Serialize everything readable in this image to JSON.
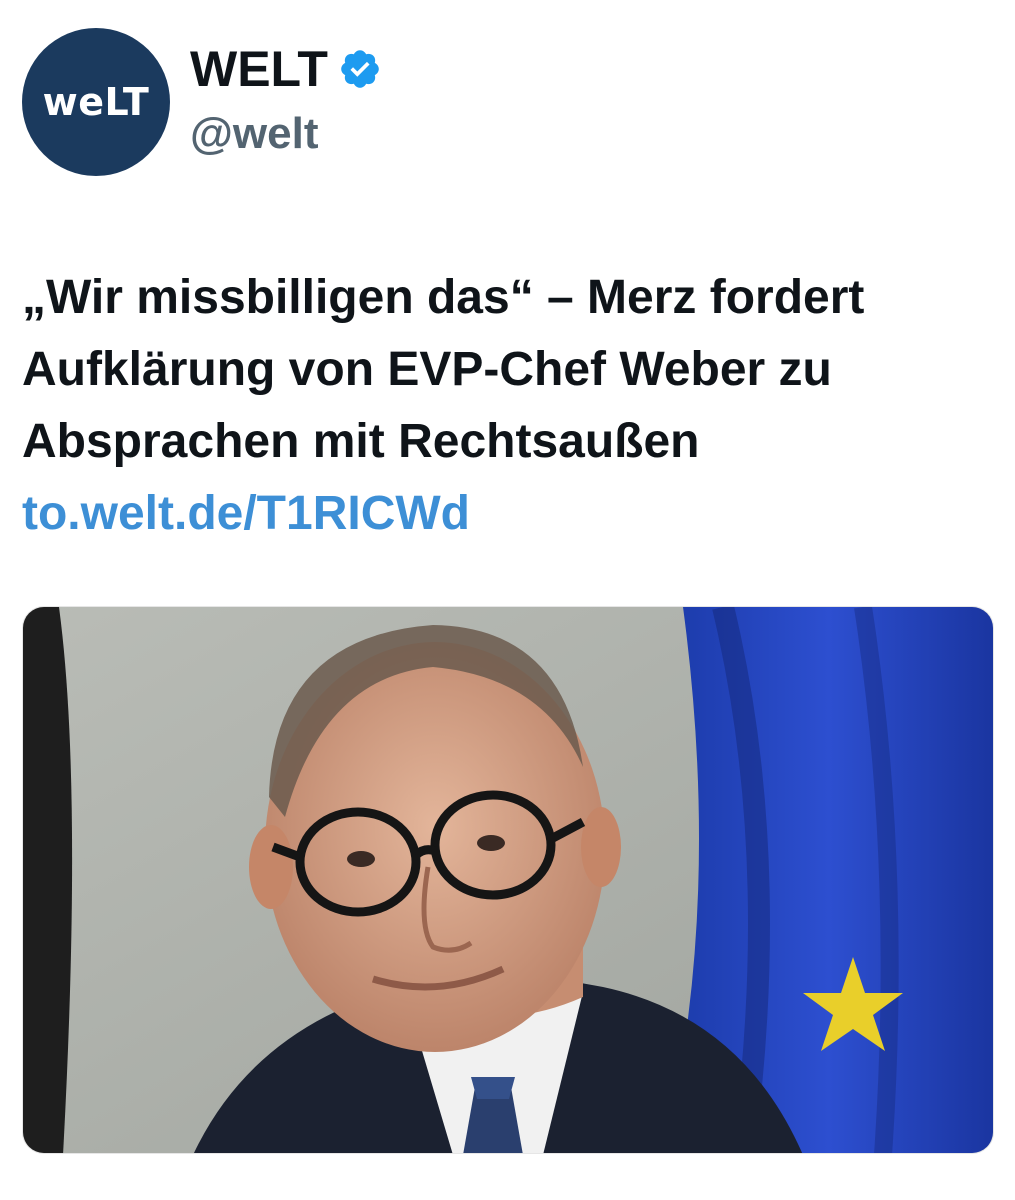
{
  "account": {
    "avatar_text": "weLT",
    "display_name": "WELT",
    "verified": true,
    "handle": "@welt"
  },
  "tweet": {
    "headline": "„Wir missbilligen das“ – Merz fordert Aufklärung von EVP-Chef Weber zu Absprachen mit Rechtsaußen",
    "link": "to.welt.de/T1RICWd"
  },
  "media": {
    "icon": "photo-icon"
  },
  "colors": {
    "avatar_bg": "#1b3a5e",
    "verified_badge": "#1d9bf0",
    "link": "#3d8fd6",
    "text": "#0f1419",
    "handle": "#536471"
  }
}
